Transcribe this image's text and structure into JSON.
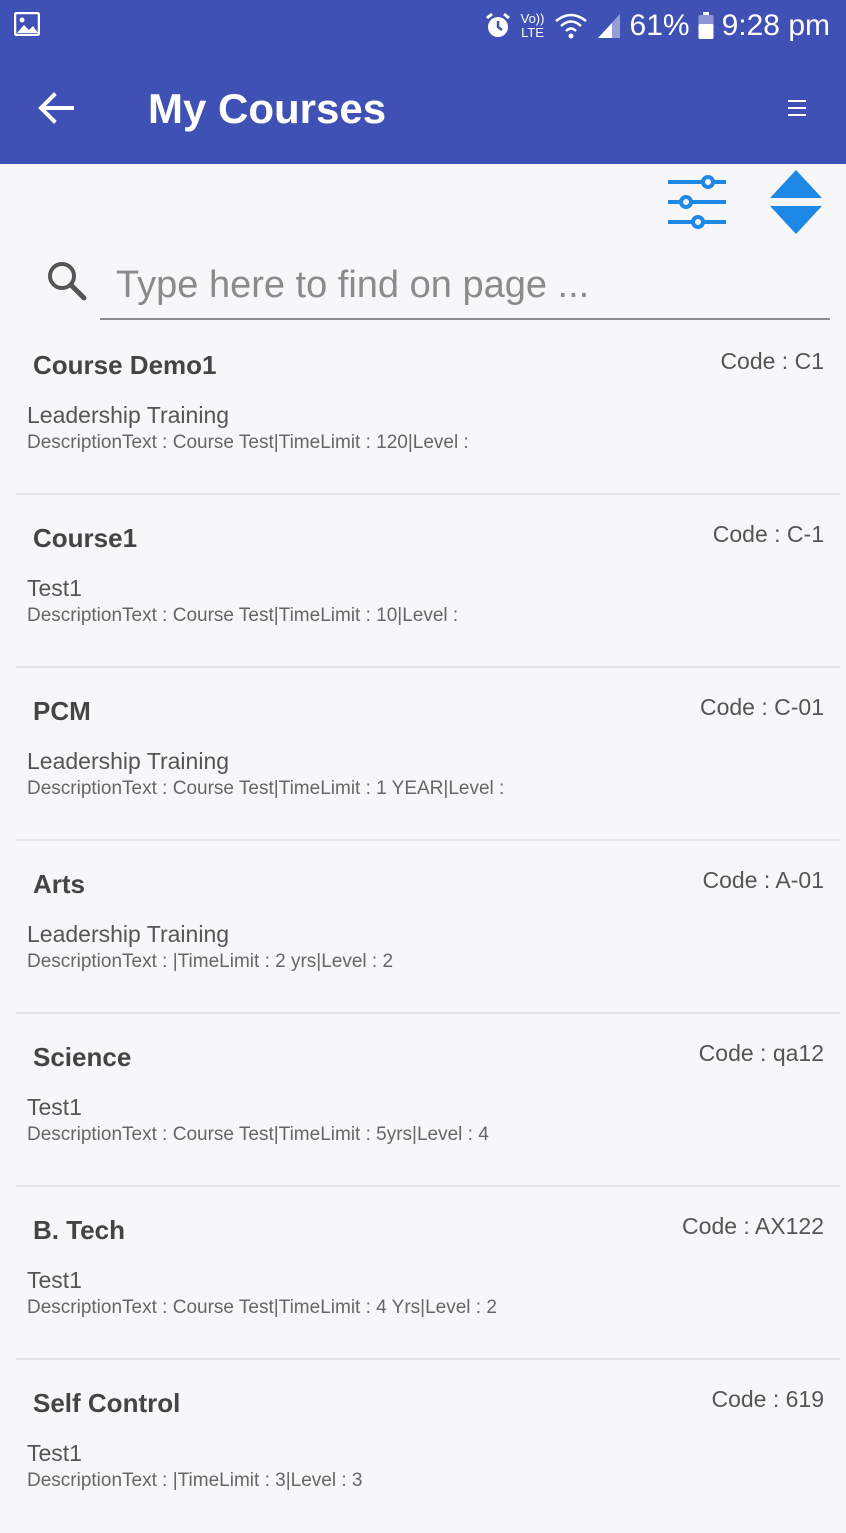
{
  "status_bar": {
    "battery": "61%",
    "time": "9:28 pm",
    "network": "Vo)) LTE"
  },
  "header": {
    "title": "My Courses"
  },
  "search": {
    "placeholder": "Type here to find on page ..."
  },
  "colors": {
    "primary": "#3f51b5",
    "accent": "#1e88e5",
    "background": "#f7f7f9"
  },
  "icons": [
    "gallery-icon",
    "alarm-icon",
    "wifi-icon",
    "signal-icon",
    "battery-icon",
    "back-arrow-icon",
    "menu-icon",
    "filter-icon",
    "sort-icon",
    "search-icon"
  ],
  "courses": [
    {
      "name": "Course Demo1",
      "code": "Code : C1",
      "subtitle": "Leadership Training",
      "description": "DescriptionText : Course Test|TimeLimit : 120|Level :"
    },
    {
      "name": "Course1",
      "code": "Code : C-1",
      "subtitle": "Test1",
      "description": "DescriptionText : Course Test|TimeLimit : 10|Level :"
    },
    {
      "name": "PCM",
      "code": "Code : C-01",
      "subtitle": "Leadership Training",
      "description": "DescriptionText : Course Test|TimeLimit : 1 YEAR|Level :"
    },
    {
      "name": "Arts",
      "code": "Code : A-01",
      "subtitle": "Leadership Training",
      "description": "DescriptionText : |TimeLimit : 2 yrs|Level : 2"
    },
    {
      "name": "Science",
      "code": "Code : qa12",
      "subtitle": "Test1",
      "description": "DescriptionText : Course Test|TimeLimit : 5yrs|Level : 4"
    },
    {
      "name": "B. Tech",
      "code": "Code : AX122",
      "subtitle": "Test1",
      "description": "DescriptionText : Course Test|TimeLimit : 4 Yrs|Level : 2"
    },
    {
      "name": "Self Control",
      "code": "Code : 619",
      "subtitle": "Test1",
      "description": "DescriptionText : |TimeLimit : 3|Level : 3"
    }
  ]
}
